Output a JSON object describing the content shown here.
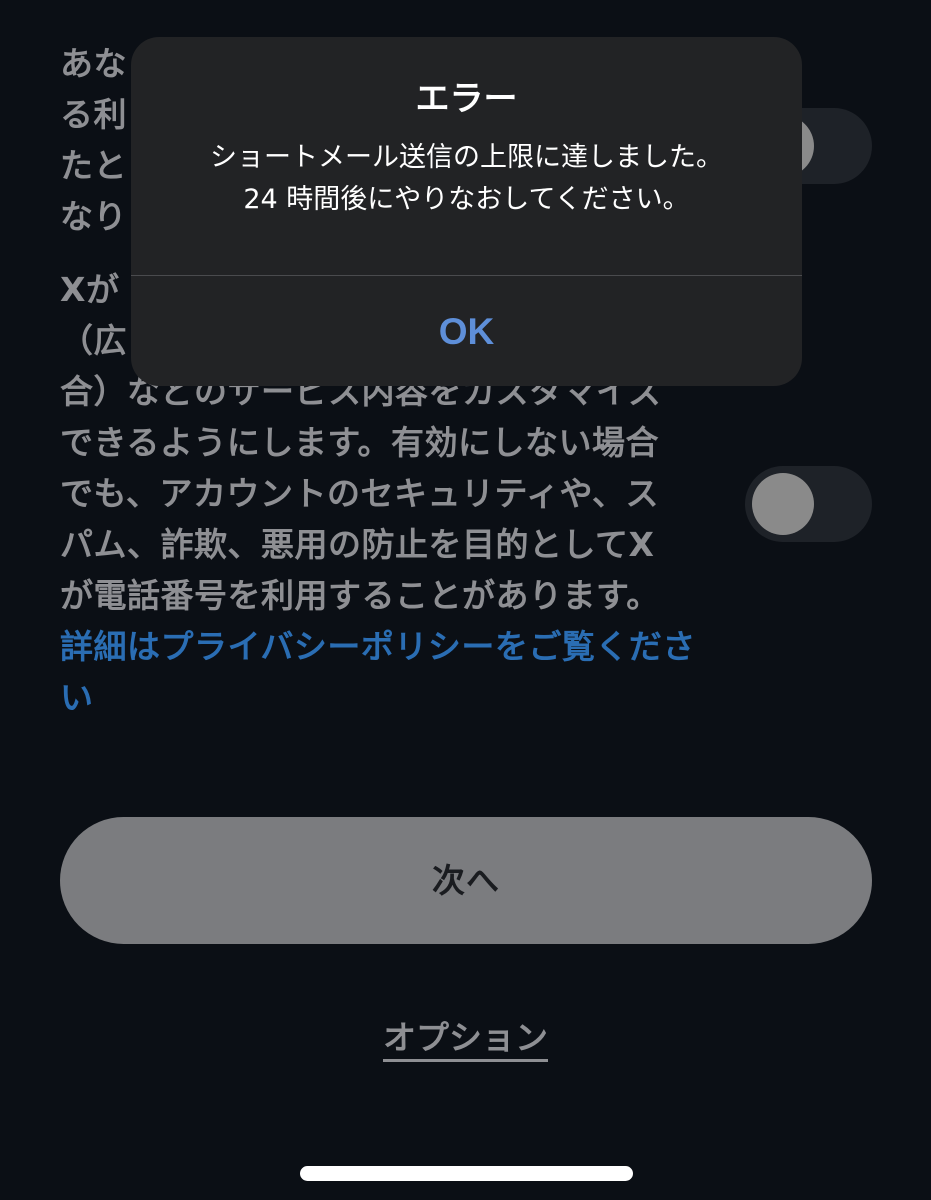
{
  "background": {
    "paragraph1_visible": "あなたの電話番号を、\nる利\nたと\nなり",
    "paragraph1_lines": [
      "あな",
      "る利",
      "たと",
      "なり"
    ],
    "paragraph2_lines": [
      "Xが",
      "（広",
      "合）などのサービス内容をカスタマイズ",
      "できるようにします。有効にしない場合",
      "でも、アカウントのセキュリティや、ス",
      "パム、詐欺、悪用の防止を目的としてX",
      "が電話番号を利用することがあります。"
    ],
    "privacy_link": "詳細はプライバシーポリシーをご覧ください"
  },
  "next_button": {
    "label": "次へ"
  },
  "options_link": {
    "label": "オプション"
  },
  "alert": {
    "title": "エラー",
    "message_line1": "ショートメール送信の上限に達しました。",
    "message_line2": "24 時間後にやりなおしてください。",
    "ok_label": "OK"
  },
  "colors": {
    "background": "#0b0f15",
    "dim_text": "#8e8f93",
    "link": "#2a6db3",
    "alert_bg": "#222325",
    "ok_text": "#5e8fd9",
    "button_bg": "#7b7c7f"
  }
}
